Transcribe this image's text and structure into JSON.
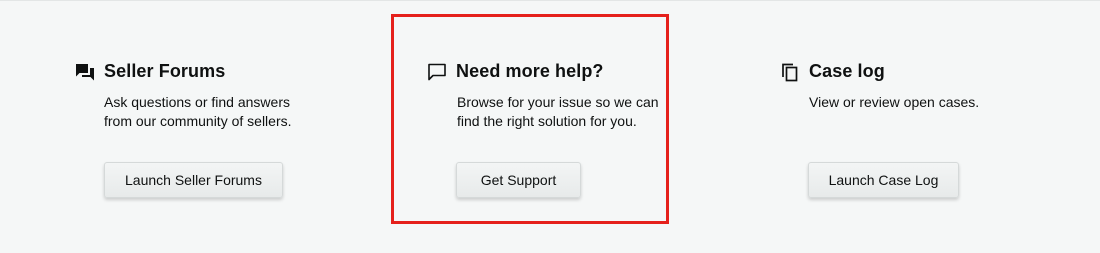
{
  "cards": [
    {
      "title": "Seller Forums",
      "description_lines": [
        "Ask questions or find answers",
        "from our community of sellers."
      ],
      "button_label": "Launch Seller Forums",
      "icon": "forum-icon"
    },
    {
      "title": "Need more help?",
      "description_lines": [
        "Browse for your issue so we can",
        "find the right solution for you."
      ],
      "button_label": "Get Support",
      "icon": "chat-bubble-icon"
    },
    {
      "title": "Case log",
      "description_lines": [
        "View or review open cases."
      ],
      "button_label": "Launch Case Log",
      "icon": "copy-icon"
    }
  ],
  "colors": {
    "background": "#f5f7f7",
    "text": "#0f1111",
    "button": "#e7eaea",
    "highlight": "#e5201c"
  }
}
